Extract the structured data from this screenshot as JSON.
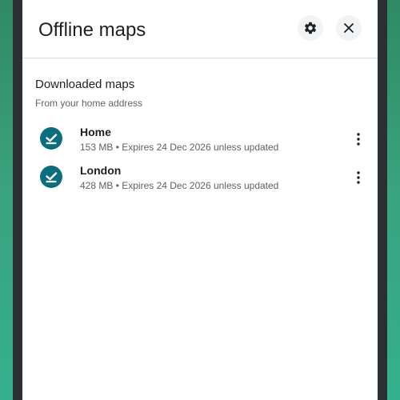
{
  "header": {
    "title": "Offline maps",
    "settings_icon": "gear-icon",
    "close_icon": "close-icon"
  },
  "section": {
    "title": "Downloaded maps",
    "subtitle": "From your home address"
  },
  "maps": [
    {
      "name": "Home",
      "details": "153 MB • Expires 24 Dec 2026 unless updated",
      "status_icon": "check-download-icon"
    },
    {
      "name": "London",
      "details": "428 MB • Expires 24 Dec 2026 unless updated",
      "status_icon": "check-download-icon"
    }
  ],
  "colors": {
    "accent": "#0b6e7f",
    "background": "#ffffff",
    "frame": "#2b2f31",
    "wallpaper": "#34b08c"
  }
}
